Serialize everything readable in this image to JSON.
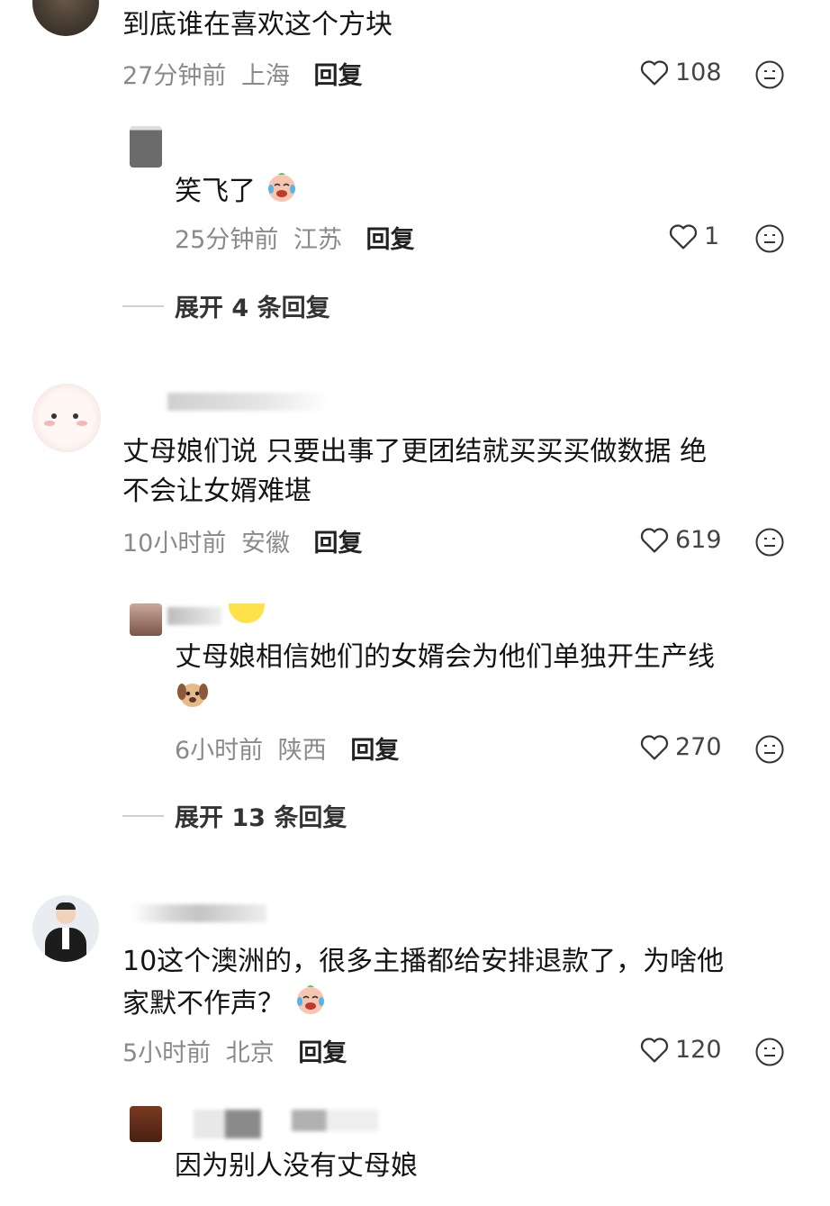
{
  "comments": [
    {
      "text": "到底谁在喜欢这个方块",
      "time": "27分钟前",
      "location": "上海",
      "reply_label": "回复",
      "likes": "108",
      "replies": [
        {
          "text": "笑飞了",
          "emoji": "laughing-crying-emoji",
          "time": "25分钟前",
          "location": "江苏",
          "reply_label": "回复",
          "likes": "1"
        }
      ],
      "expand_label": "展开 4 条回复"
    },
    {
      "text_lines": [
        "丈母娘们说 只要出事了更团结就买买买做数据 绝",
        "不会让女婿难堪"
      ],
      "time": "10小时前",
      "location": "安徽",
      "reply_label": "回复",
      "likes": "619",
      "replies": [
        {
          "text": "丈母娘相信她们的女婿会为他们单独开生产线",
          "emoji": "dog-emoji",
          "time": "6小时前",
          "location": "陕西",
          "reply_label": "回复",
          "likes": "270"
        }
      ],
      "expand_label": "展开 13 条回复"
    },
    {
      "text_lines": [
        "10这个澳洲的，很多主播都给安排退款了，为啥他",
        "家默不作声？"
      ],
      "emoji": "laughing-crying-emoji",
      "time": "5小时前",
      "location": "北京",
      "reply_label": "回复",
      "likes": "120",
      "replies": [
        {
          "text": "因为别人没有丈母娘"
        }
      ]
    }
  ],
  "colors": {
    "meta_gray": "#8a8a8a",
    "text": "#141414",
    "divider": "#cfcfcf"
  }
}
